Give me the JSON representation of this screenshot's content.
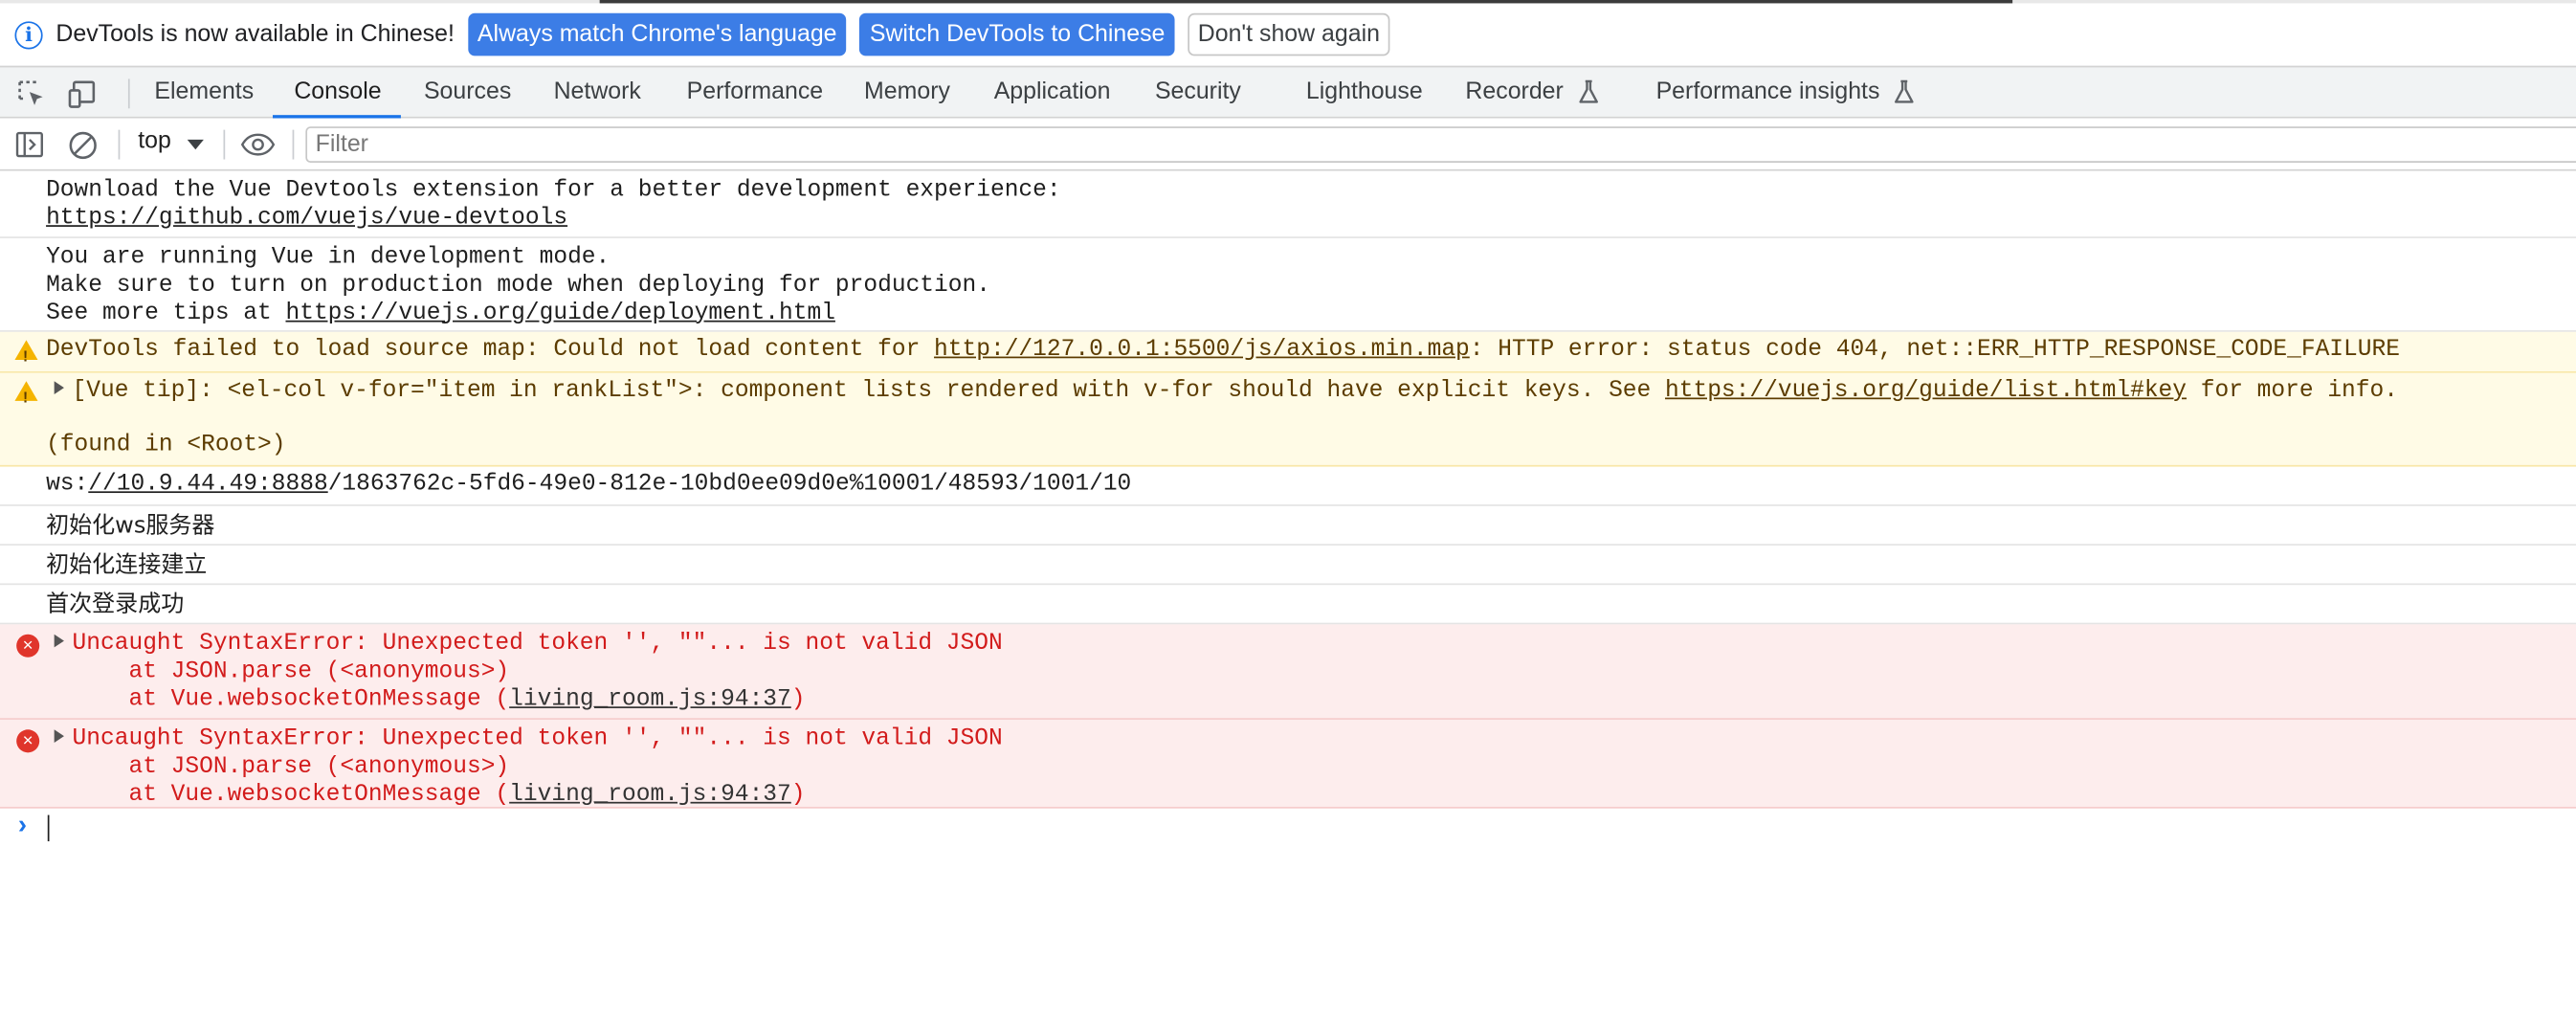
{
  "infobar": {
    "message": "DevTools is now available in Chinese!",
    "btn_match": "Always match Chrome's language",
    "btn_switch": "Switch DevTools to Chinese",
    "btn_dismiss": "Don't show again"
  },
  "tabs": [
    "Elements",
    "Console",
    "Sources",
    "Network",
    "Performance",
    "Memory",
    "Application",
    "Security",
    "Lighthouse",
    "Recorder",
    "Performance insights"
  ],
  "active_tab": "Console",
  "toolbar": {
    "context": "top",
    "filter_placeholder": "Filter"
  },
  "messages": {
    "m1_line1": "Download the Vue Devtools extension for a better development experience:",
    "m1_link": "https://github.com/vuejs/vue-devtools",
    "m2_line1": "You are running Vue in development mode.",
    "m2_line2": "Make sure to turn on production mode when deploying for production.",
    "m2_line3_prefix": "See more tips at ",
    "m2_link": "https://vuejs.org/guide/deployment.html",
    "w1_prefix": "DevTools failed to load source map: Could not load content for ",
    "w1_link": "http://127.0.0.1:5500/js/axios.min.map",
    "w1_suffix": ": HTTP error: status code 404, net::ERR_HTTP_RESPONSE_CODE_FAILURE",
    "w2_prefix": "[Vue tip]: <el-col v-for=\"item in rankList\">: component lists rendered with v-for should have explicit keys. See ",
    "w2_link": "https://vuejs.org/guide/list.html#key",
    "w2_suffix": " for more info.",
    "w2_line3": "(found in <Root>)",
    "ws_prefix": "ws:",
    "ws_link": "//10.9.44.49:8888",
    "ws_suffix": "/1863762c-5fd6-49e0-812e-10bd0ee09d0e%10001/48593/1001/10",
    "log1": "初始化ws服务器",
    "log2": "初始化连接建立",
    "log3": "首次登录成功",
    "e1_line1": "Uncaught SyntaxError: Unexpected token '', \"\"... is not valid JSON",
    "e1_line2": "    at JSON.parse (<anonymous>)",
    "e1_line3_prefix": "    at Vue.websocketOnMessage (",
    "e1_link": "living_room.js:94:37",
    "e1_line3_suffix": ")",
    "e2_line1": "Uncaught SyntaxError: Unexpected token '', \"\"... is not valid JSON",
    "e2_line2": "    at JSON.parse (<anonymous>)",
    "e2_line3_prefix": "    at Vue.websocketOnMessage (",
    "e2_link": "living_room.js:94:37",
    "e2_line3_suffix": ")"
  },
  "colors": {
    "accent": "#1a73e8",
    "warning_bg": "#fffbe6",
    "error_bg": "#fdeded",
    "error_text": "#d21b1b"
  },
  "icons": [
    "info-icon",
    "inspect-element-icon",
    "device-toggle-icon",
    "sidebar-toggle-icon",
    "clear-console-icon",
    "eye-icon",
    "flask-icon",
    "warning-icon",
    "error-icon",
    "expand-triangle-icon",
    "prompt-chevron-icon"
  ]
}
